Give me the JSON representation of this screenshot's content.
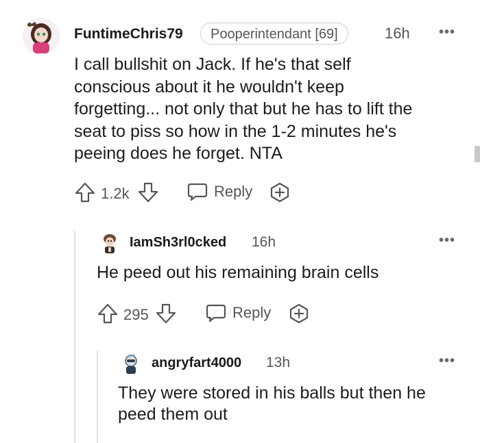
{
  "comments": [
    {
      "username": "FuntimeChris79",
      "flair": "Pooperintendant [69]",
      "time": "16h",
      "more": "•••",
      "body": [
        "I call bullshit on Jack. If he's that self",
        "conscious about it he wouldn't keep",
        "forgetting... not only that but he has to lift the",
        "seat to piss so how in the 1-2 minutes he's",
        "peeing does he forget. NTA"
      ],
      "votes": "1.2k",
      "reply_label": "Reply"
    },
    {
      "username": "IamSh3rl0cked",
      "time": "16h",
      "more": "•••",
      "body": [
        "He peed out his remaining brain cells"
      ],
      "votes": "295",
      "reply_label": "Reply"
    },
    {
      "username": "angryfart4000",
      "time": "13h",
      "more": "•••",
      "body": [
        "They were stored in his balls but then he",
        "peed them out"
      ]
    }
  ],
  "icons": {
    "upvote": "arrow-up-icon",
    "downvote": "arrow-down-icon",
    "reply": "speech-bubble-icon",
    "award": "award-plus-icon"
  },
  "colors": {
    "text": "#1c1c1c",
    "meta": "#555555",
    "thread_line": "#e3e3e3"
  }
}
